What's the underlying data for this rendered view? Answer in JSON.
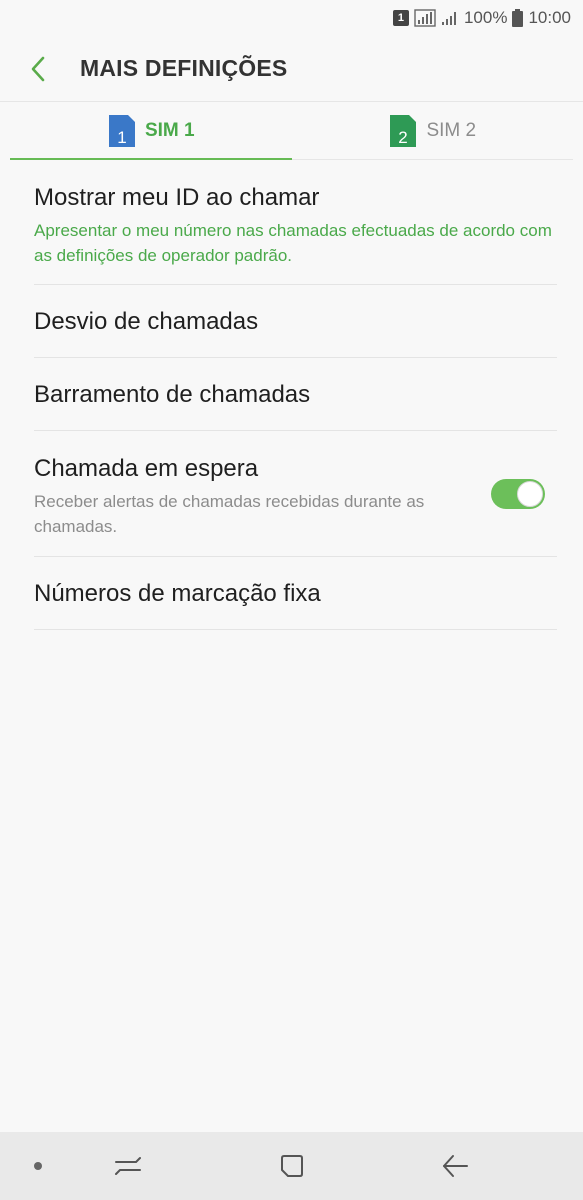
{
  "status_bar": {
    "sim_slot": "1",
    "battery": "100%",
    "time": "10:00"
  },
  "header": {
    "title": "MAIS DEFINIÇÕES"
  },
  "tabs": [
    {
      "label": "SIM 1",
      "sim_number": "1",
      "active": true,
      "color": "#3a78c8"
    },
    {
      "label": "SIM 2",
      "sim_number": "2",
      "active": false,
      "color": "#2e9a55"
    }
  ],
  "settings": [
    {
      "title": "Mostrar meu ID ao chamar",
      "subtitle": "Apresentar o meu número nas chamadas efectuadas de acordo com as definições de operador padrão."
    },
    {
      "title": "Desvio de chamadas"
    },
    {
      "title": "Barramento de chamadas"
    },
    {
      "title": "Chamada em espera",
      "subtitle": "Receber alertas de chamadas recebidas durante as chamadas.",
      "toggle_on": true
    },
    {
      "title": "Números de marcação fixa"
    }
  ],
  "colors": {
    "accent": "#4aa94a",
    "toggle": "#6cbf5a",
    "background": "#f8f8f8",
    "nav_bar": "#e9e9e9"
  },
  "icons": {
    "back": "chevron-left-icon",
    "sim": "sim-card-icon",
    "signal": "signal-icon",
    "battery": "battery-icon",
    "nav_dot": "dot-icon",
    "recents": "recent-apps-icon",
    "home": "home-icon",
    "back_nav": "arrow-left-icon"
  }
}
